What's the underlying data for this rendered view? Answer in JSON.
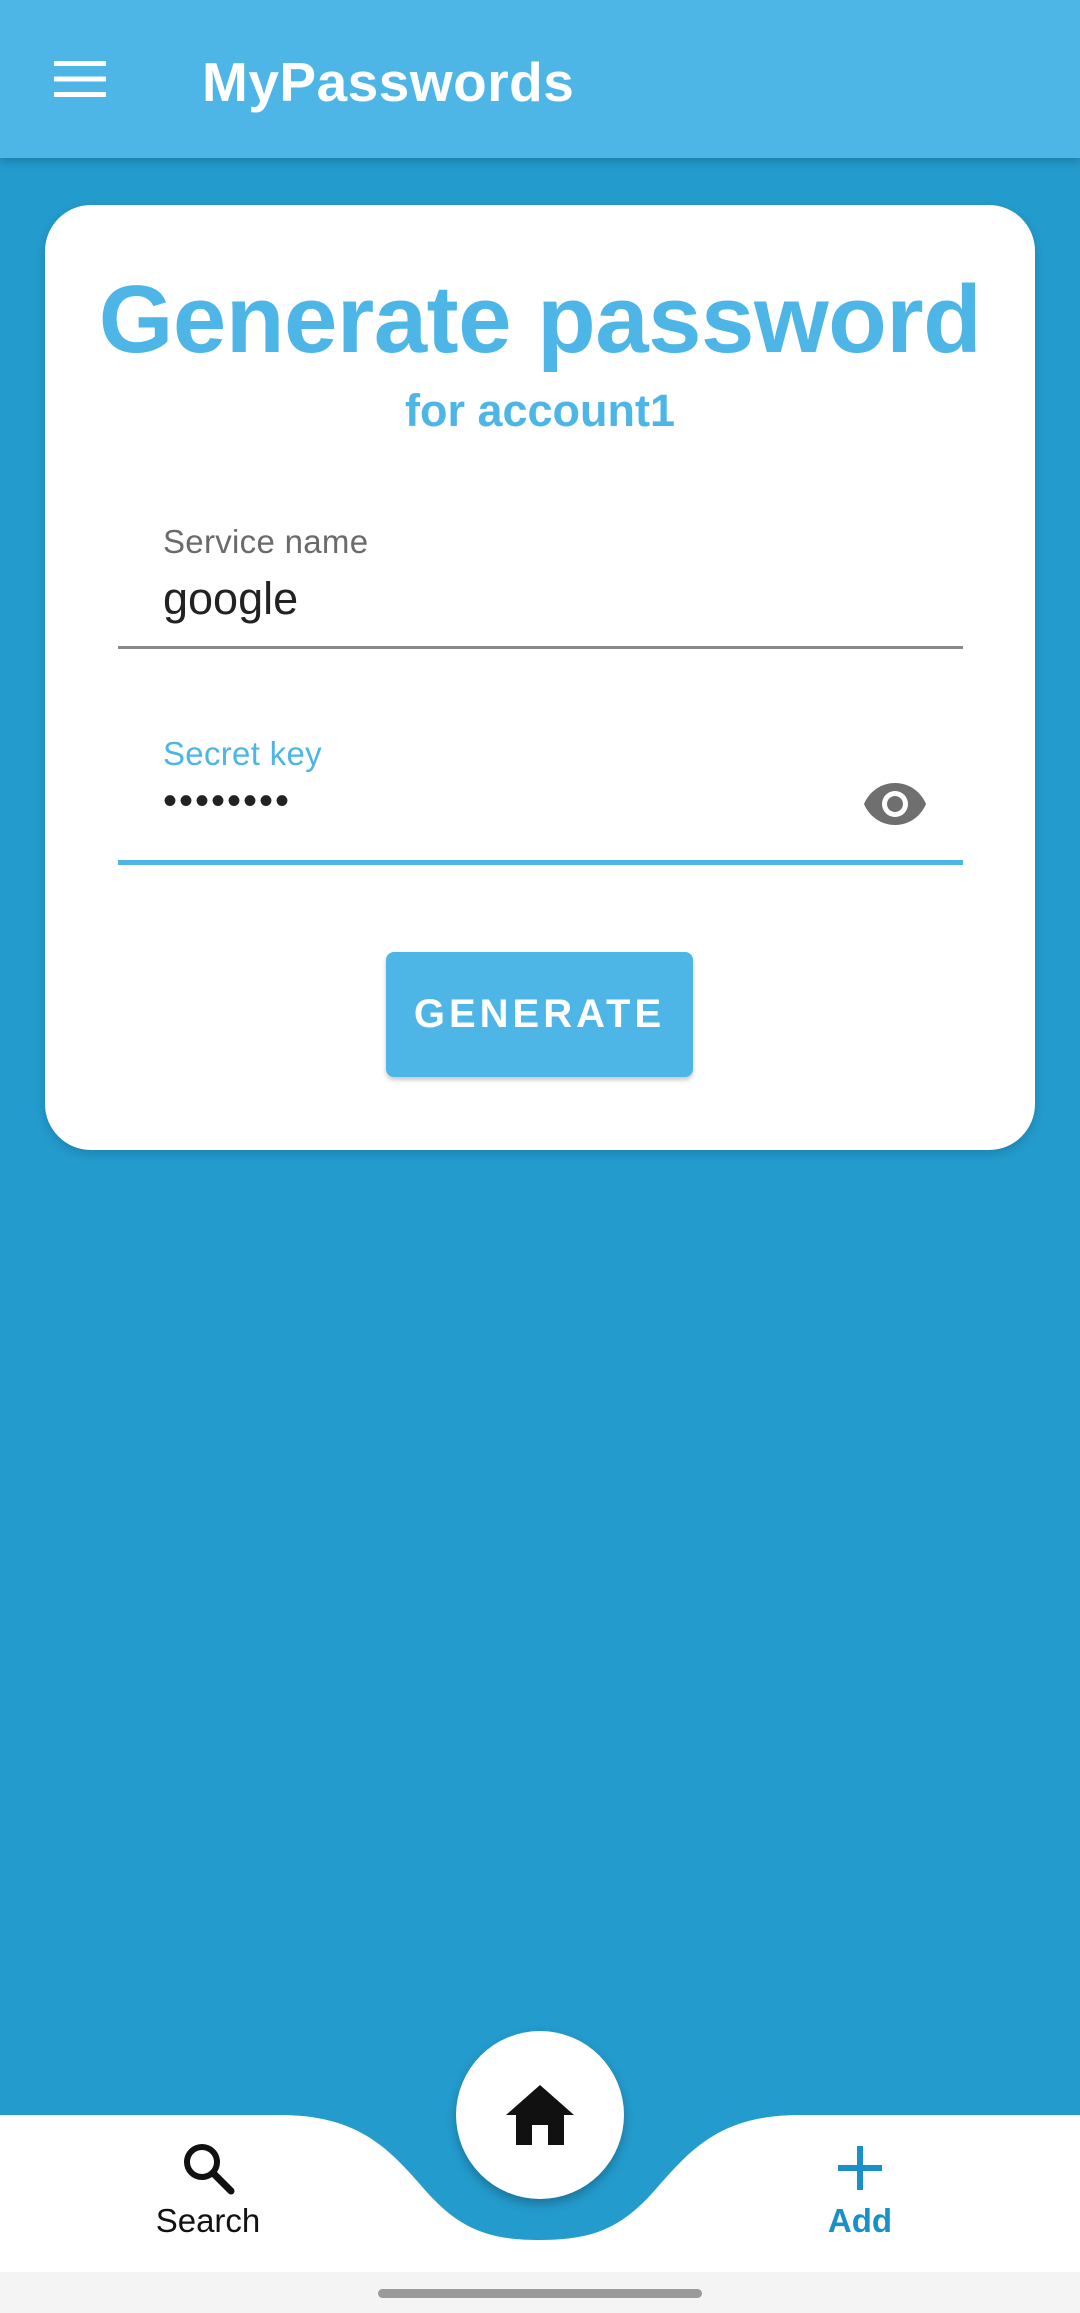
{
  "appbar": {
    "title": "MyPasswords",
    "menu_icon": "menu-icon"
  },
  "card": {
    "title": "Generate password",
    "subtitle": "for account1"
  },
  "service_field": {
    "label": "Service name",
    "value": "google"
  },
  "secret_field": {
    "label": "Secret key",
    "value": "••••••••",
    "toggle_icon": "eye-icon"
  },
  "generate_button": {
    "label": "GENERATE"
  },
  "bottom_nav": {
    "search": {
      "label": "Search",
      "icon": "search-icon"
    },
    "home": {
      "icon": "home-icon"
    },
    "add": {
      "label": "Add",
      "icon": "plus-icon"
    }
  },
  "colors": {
    "primary": "#4db6e6",
    "background": "#239bcd",
    "accent_text": "#1a90c8",
    "surface": "#ffffff"
  }
}
